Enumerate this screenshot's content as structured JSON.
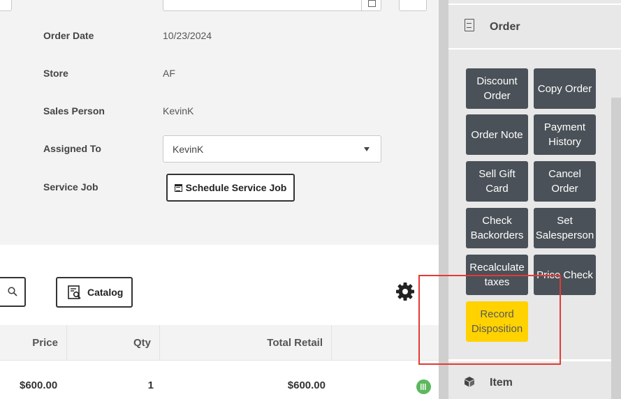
{
  "form": {
    "order_date_label": "Order Date",
    "order_date_value": "10/23/2024",
    "store_label": "Store",
    "store_value": "AF",
    "sales_person_label": "Sales Person",
    "sales_person_value": "KevinK",
    "assigned_to_label": "Assigned To",
    "assigned_to_value": "KevinK",
    "service_job_label": "Service Job",
    "schedule_button": "Schedule Service Job"
  },
  "toolbar": {
    "catalog_label": "Catalog"
  },
  "table": {
    "headers": [
      "Price",
      "Qty",
      "Total Retail"
    ],
    "rows": [
      {
        "price": "$600.00",
        "qty": "1",
        "total_retail": "$600.00"
      }
    ]
  },
  "sidebar": {
    "order_header": "Order",
    "item_header": "Item",
    "actions": [
      {
        "label": "Discount Order"
      },
      {
        "label": "Copy Order"
      },
      {
        "label": "Order Note"
      },
      {
        "label": "Payment History"
      },
      {
        "label": "Sell Gift Card"
      },
      {
        "label": "Cancel Order"
      },
      {
        "label": "Check Backorders"
      },
      {
        "label": "Set Salesperson"
      },
      {
        "label": "Recalculate taxes"
      },
      {
        "label": "Price Check"
      },
      {
        "label": "Record Disposition"
      }
    ]
  },
  "colors": {
    "action_button": "#4a5158",
    "highlight_button": "#ffd200",
    "annotation_box": "#e53935",
    "stock_indicator": "#5cb85c"
  },
  "icons": [
    "calendar-icon",
    "search-icon",
    "catalog-icon",
    "gear-icon",
    "document-icon",
    "cube-icon",
    "barcode-icon",
    "chevron-down-icon"
  ]
}
